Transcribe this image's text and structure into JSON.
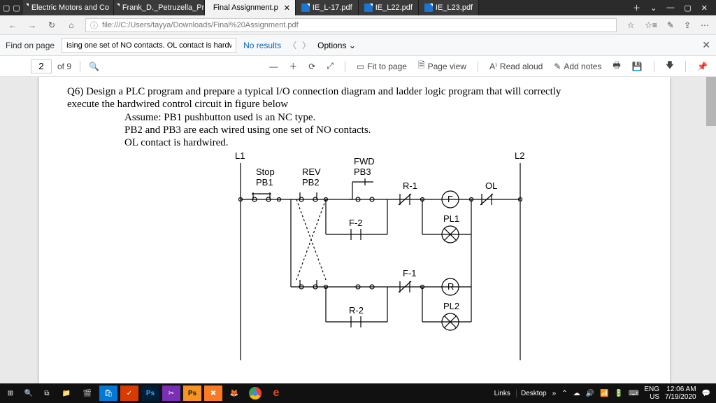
{
  "tabs": {
    "t1": "Electric Motors and Co",
    "t2": "Frank_D._Petruzella_Prc",
    "t3": "Final Assignment.p",
    "t4": "IE_L-17.pdf",
    "t5": "IE_L22.pdf",
    "t6": "IE_L23.pdf"
  },
  "addr": {
    "url": "file:///C:/Users/tayya/Downloads/Final%20Assignment.pdf"
  },
  "find": {
    "label": "Find on page",
    "value": "ising one set of NO contacts. OL contact is hardwired.",
    "no_results": "No results",
    "options": "Options"
  },
  "pdftb": {
    "page": "2",
    "of": "of 9",
    "fit": "Fit to page",
    "pageview": "Page view",
    "read": "Read aloud",
    "notes": "Add notes"
  },
  "doc": {
    "q_line1": "Q6) Design a PLC program and prepare a typical I/O connection diagram and ladder logic program that will correctly",
    "q_line2": "execute the hardwired control circuit in figure below",
    "a1": "Assume: PB1 pushbutton used is an NC type.",
    "a2": "PB2 and PB3 are each wired using one set of NO contacts.",
    "a3": "OL contact is hardwired.",
    "L1": "L1",
    "L2": "L2",
    "Stop": "Stop",
    "PB1": "PB1",
    "REV": "REV",
    "PB2": "PB2",
    "FWD": "FWD",
    "PB3": "PB3",
    "R1": "R-1",
    "OL": "OL",
    "F": "F",
    "PL1": "PL1",
    "F2": "F-2",
    "F1": "F-1",
    "R": "R",
    "PL2": "PL2",
    "R2": "R-2"
  },
  "tray": {
    "links": "Links",
    "desktop": "Desktop",
    "lang": "ENG",
    "region": "US",
    "time": "12:06 AM",
    "date": "7/19/2020"
  }
}
